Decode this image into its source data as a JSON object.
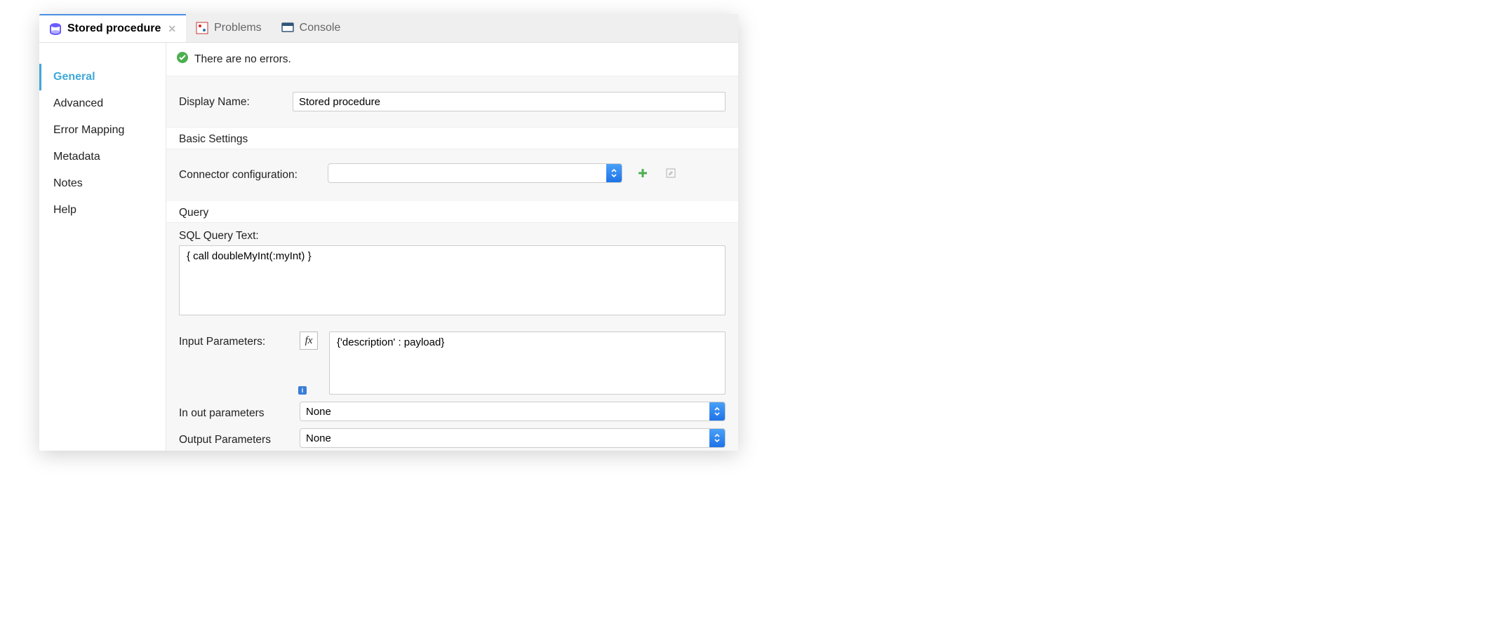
{
  "tabs": {
    "active": {
      "label": "Stored procedure"
    },
    "problems": {
      "label": "Problems"
    },
    "console": {
      "label": "Console"
    }
  },
  "sidebar": {
    "items": [
      {
        "label": "General",
        "active": true
      },
      {
        "label": "Advanced"
      },
      {
        "label": "Error Mapping"
      },
      {
        "label": "Metadata"
      },
      {
        "label": "Notes"
      },
      {
        "label": "Help"
      }
    ]
  },
  "status": {
    "message": "There are no errors."
  },
  "form": {
    "displayNameLabel": "Display Name:",
    "displayNameValue": "Stored procedure",
    "basicSettingsTitle": "Basic Settings",
    "connectorConfigLabel": "Connector configuration:",
    "connectorConfigValue": "",
    "queryTitle": "Query",
    "sqlLabel": "SQL Query Text:",
    "sqlValue": "{ call doubleMyInt(:myInt) }",
    "inputParamsLabel": "Input Parameters:",
    "inputParamsValue": "{'description' : payload}",
    "inOutParamsLabel": "In out parameters",
    "inOutParamsValue": "None",
    "outputParamsLabel": "Output Parameters",
    "outputParamsValue": "None",
    "fxLabel": "fx"
  }
}
